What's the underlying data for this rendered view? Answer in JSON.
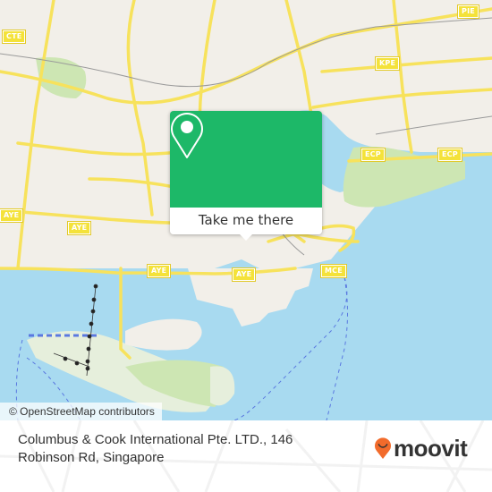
{
  "map": {
    "road_shields": [
      {
        "label": "CTE",
        "id": "cte"
      },
      {
        "label": "PIE",
        "id": "pie"
      },
      {
        "label": "KPE",
        "id": "kpe"
      },
      {
        "label": "ECP",
        "id": "ecp1"
      },
      {
        "label": "ECP",
        "id": "ecp2"
      },
      {
        "label": "AYE",
        "id": "aye1"
      },
      {
        "label": "AYE",
        "id": "aye2"
      },
      {
        "label": "AYE",
        "id": "aye3"
      },
      {
        "label": "AYE",
        "id": "aye4"
      },
      {
        "label": "MCE",
        "id": "mce"
      }
    ],
    "colors": {
      "land": "#f2efe9",
      "water": "#a8daf0",
      "park": "#cde6b3",
      "road": "#f7e25c",
      "accent": "#1db868"
    },
    "attribution": "© OpenStreetMap contributors"
  },
  "popup": {
    "icon": "location-pin-icon",
    "button_label": "Take me there"
  },
  "footer": {
    "address": "Columbus & Cook International Pte. LTD., 146 Robinson Rd, Singapore",
    "brand": "moovit",
    "brand_icon": "moovit-smile-pin-icon",
    "brand_color": "#f26b2b"
  }
}
